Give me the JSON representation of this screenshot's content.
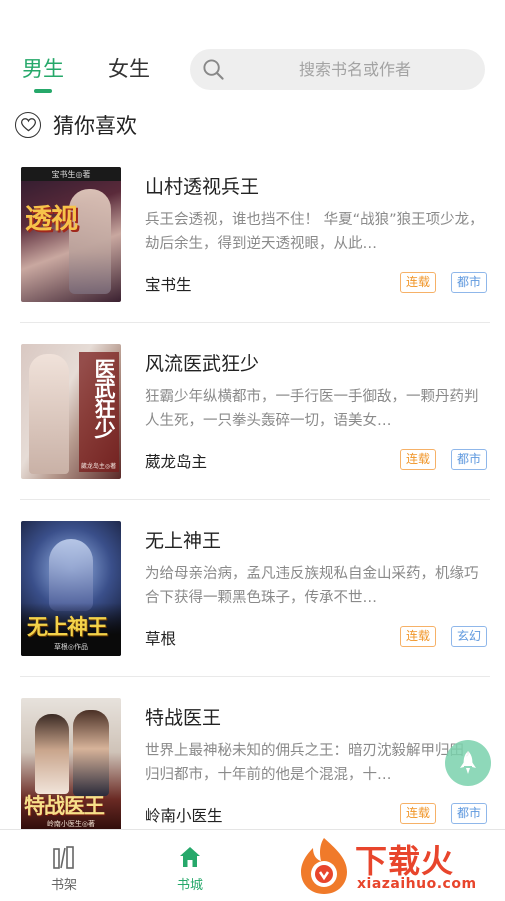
{
  "header": {
    "tabs": [
      {
        "label": "男生",
        "active": true
      },
      {
        "label": "女生",
        "active": false
      }
    ],
    "search": {
      "placeholder": "搜索书名或作者",
      "value": ""
    }
  },
  "section": {
    "title": "猜你喜欢",
    "icon": "heart-icon"
  },
  "books": [
    {
      "title": "山村透视兵王",
      "desc": "兵王会透视，谁也挡不住！ 华夏“战狼”狼王项少龙，劫后余生，得到逆天透视眼，从此…",
      "author": "宝书生",
      "status": "连载",
      "genre": "都市",
      "cover": {
        "title": "透视",
        "author": "宝书生◎著"
      }
    },
    {
      "title": "风流医武狂少",
      "desc": "狂霸少年纵横都市，一手行医一手御敌，一颗丹药判人生死，一只拳头轰碎一切，语美女…",
      "author": "葳龙岛主",
      "status": "连载",
      "genre": "都市",
      "cover": {
        "title": "医武狂少",
        "author": "葳龙岛主◎著"
      }
    },
    {
      "title": "无上神王",
      "desc": "为给母亲治病，孟凡违反族规私自金山采药，机缘巧合下获得一颗黑色珠子，传承不世…",
      "author": "草根",
      "status": "连载",
      "genre": "玄幻",
      "cover": {
        "title": "无上神王",
        "author": "草根◎作品"
      }
    },
    {
      "title": "特战医王",
      "desc": "世界上最神秘未知的佣兵之王：暗刃沈毅解甲归田，归归都市，十年前的他是个混混，十…",
      "author": "岭南小医生",
      "status": "连载",
      "genre": "都市",
      "cover": {
        "title": "特战医王",
        "author": "岭南小医生◎著"
      }
    }
  ],
  "bottom_nav": [
    {
      "label": "书架",
      "icon": "bookshelf-icon",
      "active": false
    },
    {
      "label": "书城",
      "icon": "home-icon",
      "active": true
    }
  ],
  "watermark": {
    "text": "下载火",
    "url": "xiazaihuo.com"
  },
  "colors": {
    "accent": "#26a86a",
    "status_tag": "#f0962a",
    "genre_tag": "#5e98de",
    "watermark": "#e8452c"
  }
}
